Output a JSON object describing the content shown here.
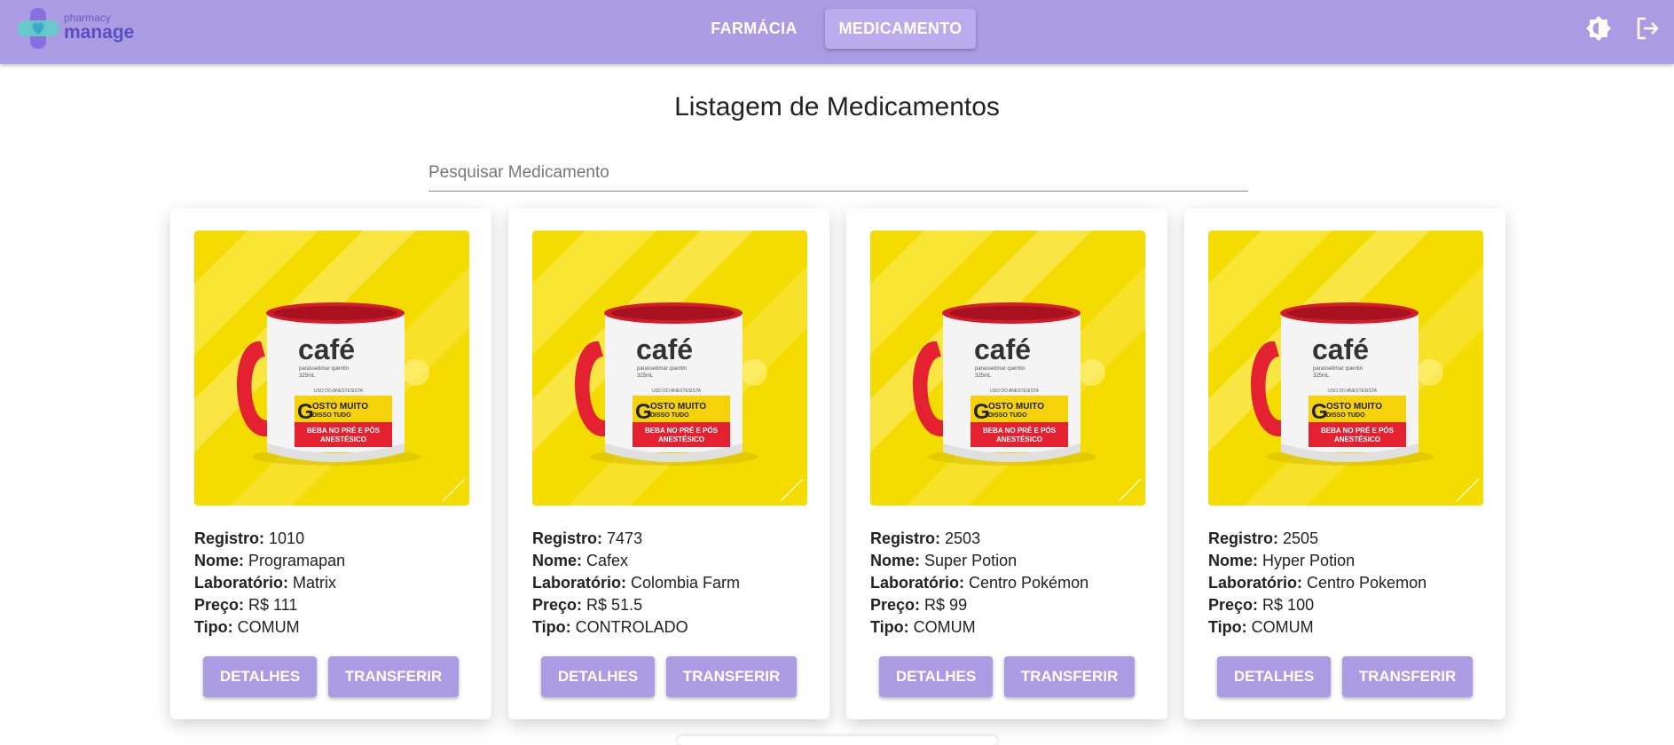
{
  "brand": {
    "small": "pharmacy",
    "big": "manage"
  },
  "nav": {
    "farmacia": "FARMÁCIA",
    "medicamento": "MEDICAMENTO"
  },
  "icons": {
    "theme": "brightness-icon",
    "logout": "logout-icon"
  },
  "colors": {
    "primary": "#aa9ce3",
    "active_tab": "#b8acec",
    "image_bg": "#f5dc00"
  },
  "page": {
    "title": "Listagem de Medicamentos"
  },
  "search": {
    "placeholder": "Pesquisar Medicamento",
    "value": ""
  },
  "labels": {
    "registro": "Registro:",
    "nome": "Nome:",
    "laboratorio": "Laboratório:",
    "preco": "Preço:",
    "tipo": "Tipo:",
    "detalhes": "DETALHES",
    "transferir": "TRANSFERIR"
  },
  "mug": {
    "cafe": "café",
    "sub": "parassetimar quentin",
    "ml": "325mL",
    "uso": "USO DO ANESTESISTA",
    "g": "G",
    "gosto1": "OSTO MUITO",
    "gosto2": "DISSO TUDO",
    "beba1": "BEBA NO PRÉ E PÓS",
    "beba2": "ANESTÉSICO"
  },
  "medicamentos": [
    {
      "registro": "1010",
      "nome": "Programapan",
      "laboratorio": "Matrix",
      "preco": "R$ 111",
      "tipo": "COMUM"
    },
    {
      "registro": "7473",
      "nome": "Cafex",
      "laboratorio": "Colombia Farm",
      "preco": "R$ 51.5",
      "tipo": "CONTROLADO"
    },
    {
      "registro": "2503",
      "nome": "Super Potion",
      "laboratorio": "Centro Pokémon",
      "preco": "R$ 99",
      "tipo": "COMUM"
    },
    {
      "registro": "2505",
      "nome": "Hyper Potion",
      "laboratorio": "Centro Pokemon",
      "preco": "R$ 100",
      "tipo": "COMUM"
    }
  ]
}
